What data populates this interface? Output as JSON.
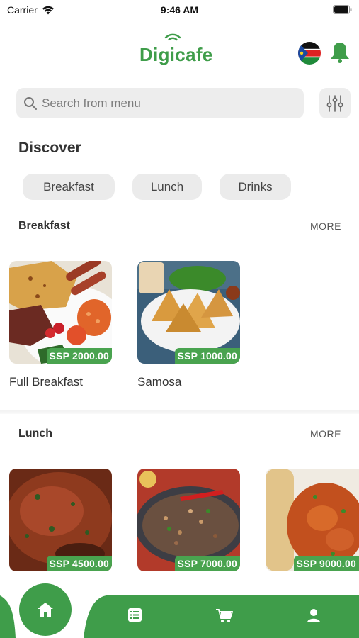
{
  "status_bar": {
    "carrier": "Carrier",
    "time": "9:46 AM"
  },
  "header": {
    "app_name": "Digicafe"
  },
  "search": {
    "placeholder": "Search from menu"
  },
  "discover": {
    "title": "Discover",
    "categories": [
      "Breakfast",
      "Lunch",
      "Drinks"
    ]
  },
  "sections": [
    {
      "title": "Breakfast",
      "more_label": "MORE",
      "items": [
        {
          "name": "Full Breakfast",
          "price": "SSP 2000.00"
        },
        {
          "name": "Samosa",
          "price": "SSP 1000.00"
        }
      ]
    },
    {
      "title": "Lunch",
      "more_label": "MORE",
      "items": [
        {
          "name": "",
          "price": "SSP 4500.00"
        },
        {
          "name": "",
          "price": "SSP 7000.00"
        },
        {
          "name": "",
          "price": "SSP 9000.00"
        }
      ]
    }
  ],
  "colors": {
    "brand": "#3f9d4a",
    "chip_bg": "#ebebeb",
    "search_bg": "#ededed"
  },
  "nav": {
    "icons": [
      "home-icon",
      "menu-list-icon",
      "cart-icon",
      "profile-icon"
    ]
  }
}
